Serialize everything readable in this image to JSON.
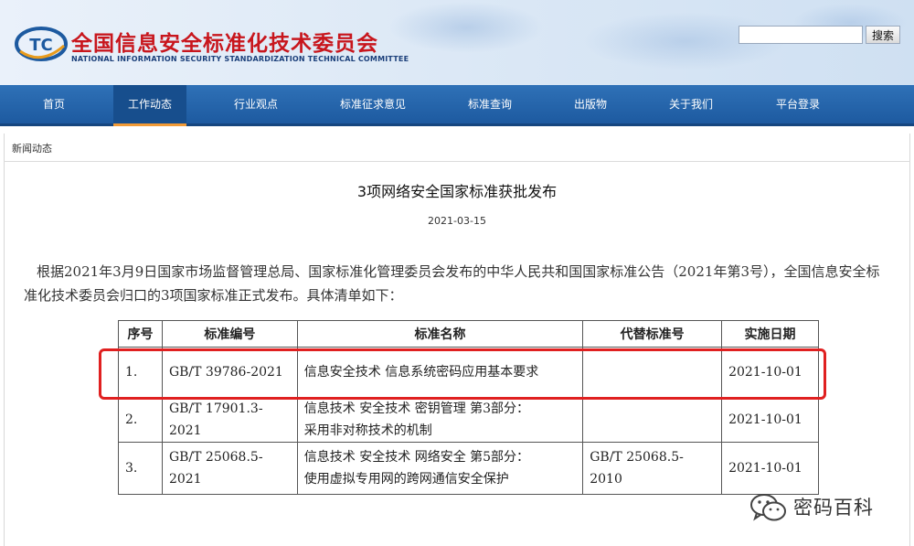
{
  "header": {
    "logo_abbr": "TC",
    "title": "全国信息安全标准化技术委员会",
    "subtitle": "NATIONAL INFORMATION SECURITY STANDARDIZATION TECHNICAL COMMITTEE",
    "search_placeholder": "",
    "search_button": "搜索"
  },
  "nav": {
    "items": [
      {
        "label": "首页"
      },
      {
        "label": "工作动态",
        "active": true
      },
      {
        "label": "行业观点"
      },
      {
        "label": "标准征求意见"
      },
      {
        "label": "标准查询"
      },
      {
        "label": "出版物"
      },
      {
        "label": "关于我们"
      },
      {
        "label": "平台登录"
      }
    ]
  },
  "breadcrumb": "新闻动态",
  "article": {
    "title": "3项网络安全国家标准获批发布",
    "date": "2021-03-15",
    "body": "根据2021年3月9日国家市场监督管理总局、国家标准化管理委员会发布的中华人民共和国国家标准公告（2021年第3号），全国信息安全标准化技术委员会归口的3项国家标准正式发布。具体清单如下："
  },
  "table": {
    "headers": [
      "序号",
      "标准编号",
      "标准名称",
      "代替标准号",
      "实施日期"
    ],
    "rows": [
      {
        "no": "1.",
        "code": "GB/T 39786-2021",
        "name_line1": "信息安全技术 信息系统密码应用基本要求",
        "name_line2": "",
        "replaces": "",
        "date": "2021-10-01"
      },
      {
        "no": "2.",
        "code": "GB/T 17901.3-2021",
        "name_line1": "信息技术 安全技术 密钥管理 第3部分：",
        "name_line2": "采用非对称技术的机制",
        "replaces": "",
        "date": "2021-10-01"
      },
      {
        "no": "3.",
        "code": "GB/T 25068.5-2021",
        "name_line1": "信息技术 安全技术 网络安全 第5部分：",
        "name_line2": "使用虚拟专用网的跨网通信安全保护",
        "replaces": "GB/T 25068.5-2010",
        "date": "2021-10-01"
      }
    ]
  },
  "watermark": {
    "text": "密码百科",
    "icon": "wechat-icon"
  },
  "colors": {
    "title_red": "#c8161d",
    "nav_blue": "#1d5aa0",
    "nav_active_accent": "#f19a36",
    "highlight_red": "#e02020"
  }
}
